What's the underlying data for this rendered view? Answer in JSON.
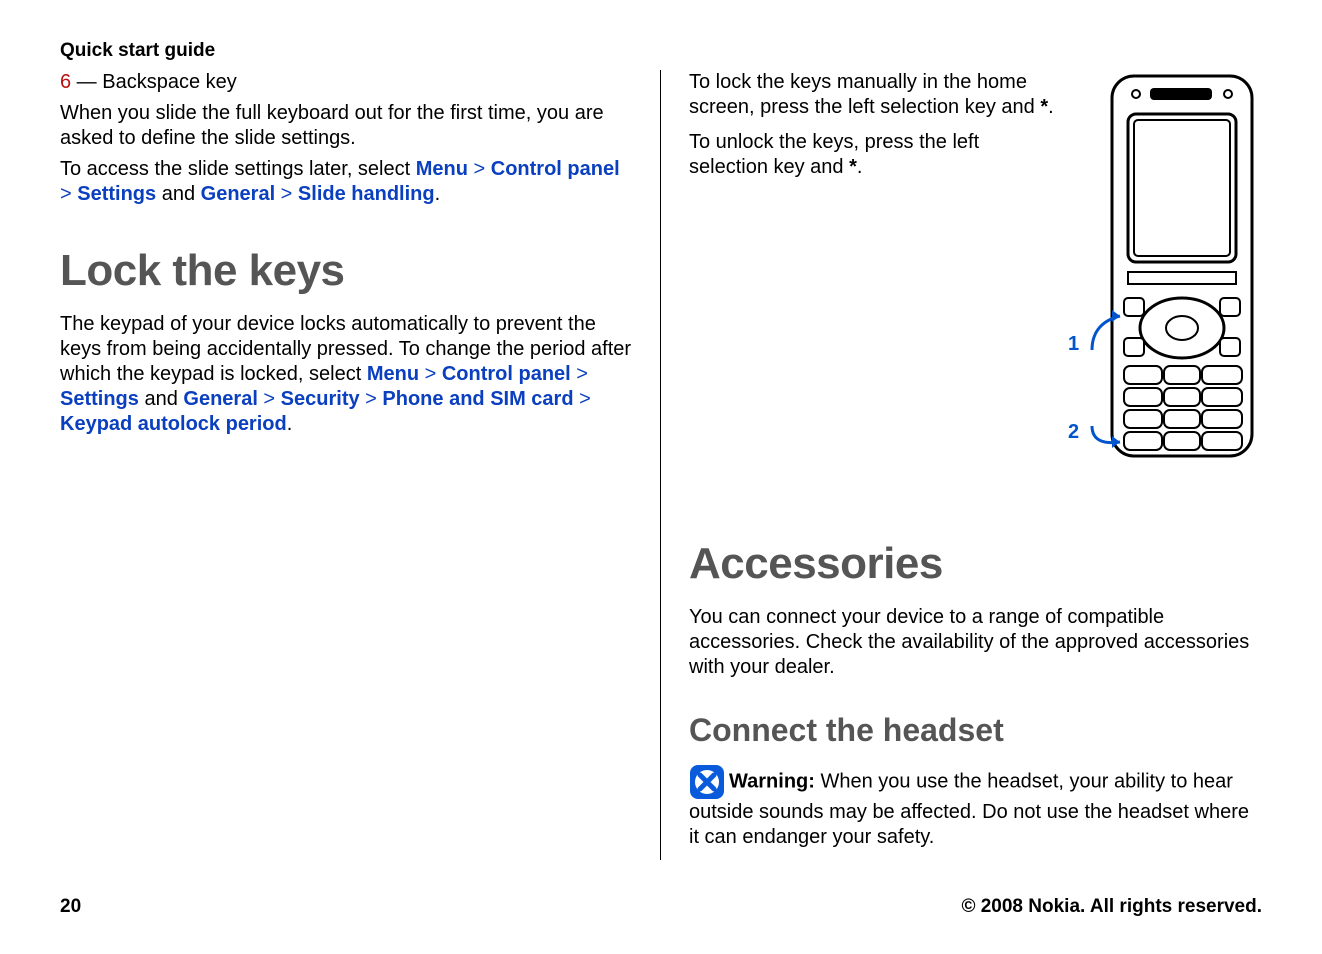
{
  "header": {
    "section_title": "Quick start guide"
  },
  "left": {
    "backspace_prefix": "6",
    "backspace_rest": " — Backspace key",
    "slide_intro": "When you slide the full keyboard out for the first time, you are asked to define the slide settings.",
    "access_prefix": "To access the slide settings later, select ",
    "nav1": {
      "menu": "Menu",
      "cp": "Control panel",
      "settings": "Settings",
      "and": " and ",
      "general": "General",
      "slide": "Slide handling",
      "gt": " > ",
      "period": "."
    },
    "h1": "Lock the keys",
    "lock_intro": "The keypad of your device locks automatically to prevent the keys from being accidentally pressed. To change the period after which the keypad is locked, select ",
    "nav2": {
      "menu": "Menu",
      "cp": "Control panel",
      "settings": "Settings",
      "and": " and ",
      "general": "General",
      "security": "Security",
      "phonesim": "Phone and SIM card",
      "autolock": "Keypad autolock period",
      "gt": " > ",
      "period": "."
    }
  },
  "right": {
    "lock_manual": "To lock the keys manually in the home screen, press the left selection key and ",
    "star": "*",
    "dot": ".",
    "unlock": "To unlock the keys, press the left selection key and ",
    "callout1": "1",
    "callout2": "2",
    "h1_acc": "Accessories",
    "acc_body": "You can connect your device to a range of compatible accessories. Check the availability of the approved accessories with your dealer.",
    "h2_headset": "Connect the headset",
    "warn_label": "Warning:  ",
    "warn_body": "When you use the headset, your ability to hear outside sounds may be affected. Do not use the headset where it can endanger your safety."
  },
  "footer": {
    "page_no": "20",
    "copyright": "© 2008 Nokia. All rights reserved."
  }
}
